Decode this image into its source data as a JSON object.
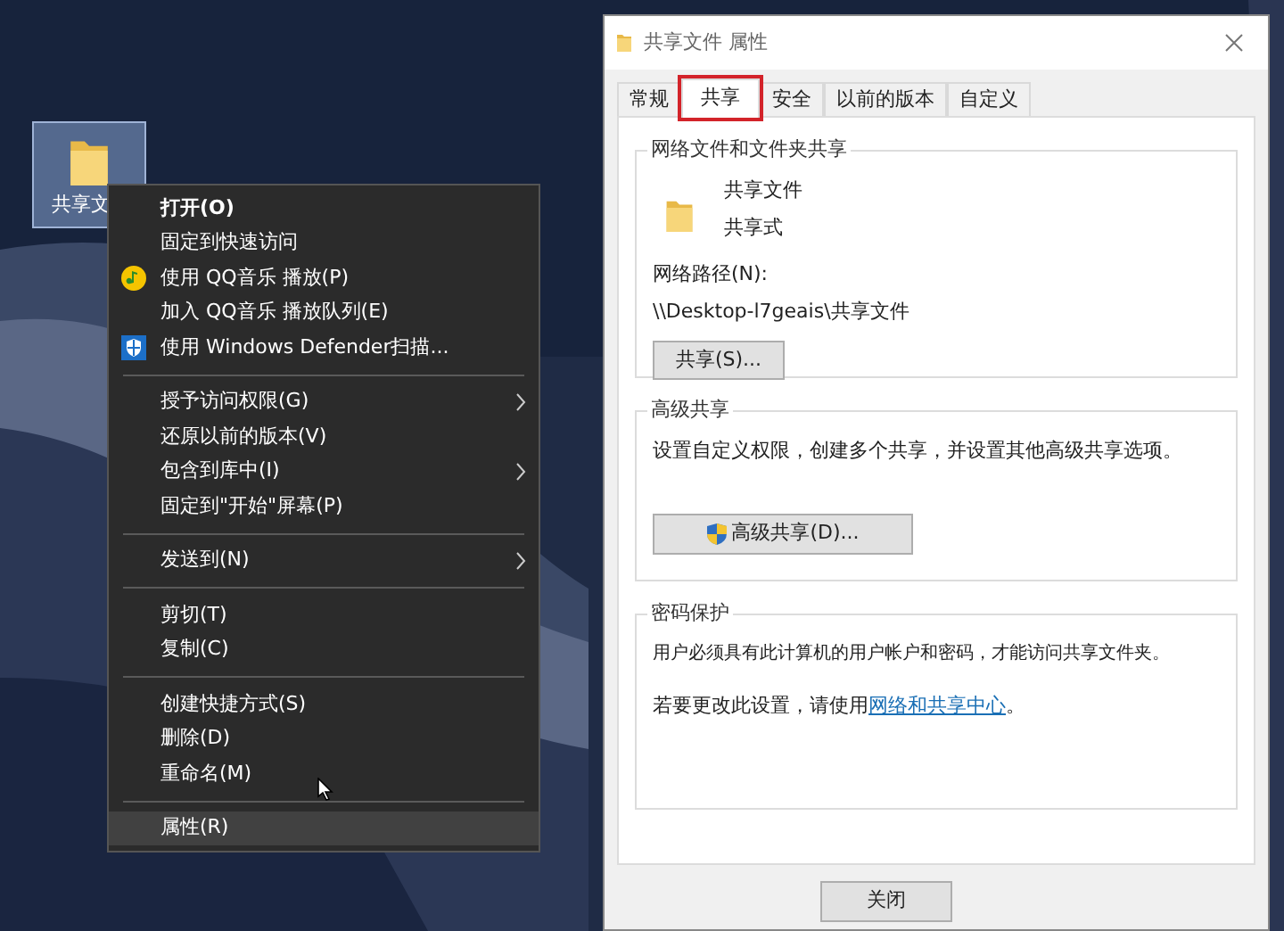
{
  "desktop": {
    "icon": {
      "label": "共享文",
      "selected": true
    }
  },
  "context_menu": {
    "items": [
      {
        "kind": "item",
        "label": "打开(O)",
        "bold": true,
        "submenu": false,
        "selected": false
      },
      {
        "kind": "item",
        "label": "固定到快速访问",
        "bold": false,
        "submenu": false,
        "selected": false
      },
      {
        "kind": "music",
        "label": "使用 QQ音乐 播放(P)",
        "bold": false,
        "submenu": false,
        "selected": false
      },
      {
        "kind": "item",
        "label": "加入 QQ音乐 播放队列(E)",
        "bold": false,
        "submenu": false,
        "selected": false
      },
      {
        "kind": "shield",
        "label": "使用 Windows Defender扫描...",
        "bold": false,
        "submenu": false,
        "selected": false
      },
      {
        "kind": "separator"
      },
      {
        "kind": "item",
        "label": "授予访问权限(G)",
        "bold": false,
        "submenu": true,
        "selected": false
      },
      {
        "kind": "item",
        "label": "还原以前的版本(V)",
        "bold": false,
        "submenu": false,
        "selected": false
      },
      {
        "kind": "item",
        "label": "包含到库中(I)",
        "bold": false,
        "submenu": true,
        "selected": false
      },
      {
        "kind": "item",
        "label": "固定到\"开始\"屏幕(P)",
        "bold": false,
        "submenu": false,
        "selected": false
      },
      {
        "kind": "separator"
      },
      {
        "kind": "item",
        "label": "发送到(N)",
        "bold": false,
        "submenu": true,
        "selected": false
      },
      {
        "kind": "separator"
      },
      {
        "kind": "item",
        "label": "剪切(T)",
        "bold": false,
        "submenu": false,
        "selected": false
      },
      {
        "kind": "item",
        "label": "复制(C)",
        "bold": false,
        "submenu": false,
        "selected": false
      },
      {
        "kind": "separator"
      },
      {
        "kind": "item",
        "label": "创建快捷方式(S)",
        "bold": false,
        "submenu": false,
        "selected": false
      },
      {
        "kind": "item",
        "label": "删除(D)",
        "bold": false,
        "submenu": false,
        "selected": false
      },
      {
        "kind": "item",
        "label": "重命名(M)",
        "bold": false,
        "submenu": false,
        "selected": false
      },
      {
        "kind": "separator"
      },
      {
        "kind": "item",
        "label": "属性(R)",
        "bold": false,
        "submenu": false,
        "selected": true
      }
    ]
  },
  "dialog": {
    "title": "共享文件 属性",
    "tabs": [
      {
        "label": "常规",
        "selected": false,
        "highlighted": false
      },
      {
        "label": "共享",
        "selected": true,
        "highlighted": true
      },
      {
        "label": "安全",
        "selected": false,
        "highlighted": false
      },
      {
        "label": "以前的版本",
        "selected": false,
        "highlighted": false
      },
      {
        "label": "自定义",
        "selected": false,
        "highlighted": false
      }
    ],
    "network_sharing": {
      "heading": "网络文件和文件夹共享",
      "name": "共享文件",
      "status": "共享式",
      "path_label": "网络路径(N):",
      "path": "\\\\Desktop-l7geais\\共享文件",
      "button": "共享(S)..."
    },
    "advanced_sharing": {
      "heading": "高级共享",
      "description": "设置自定义权限，创建多个共享，并设置其他高级共享选项。",
      "button": "高级共享(D)..."
    },
    "password_protection": {
      "heading": "密码保护",
      "description": "用户必须具有此计算机的用户帐户和密码，才能访问共享文件夹。",
      "prompt": "若要更改此设置，请使用",
      "link": "网络和共享中心",
      "after_link": "。"
    },
    "buttons": [
      "关闭"
    ]
  }
}
